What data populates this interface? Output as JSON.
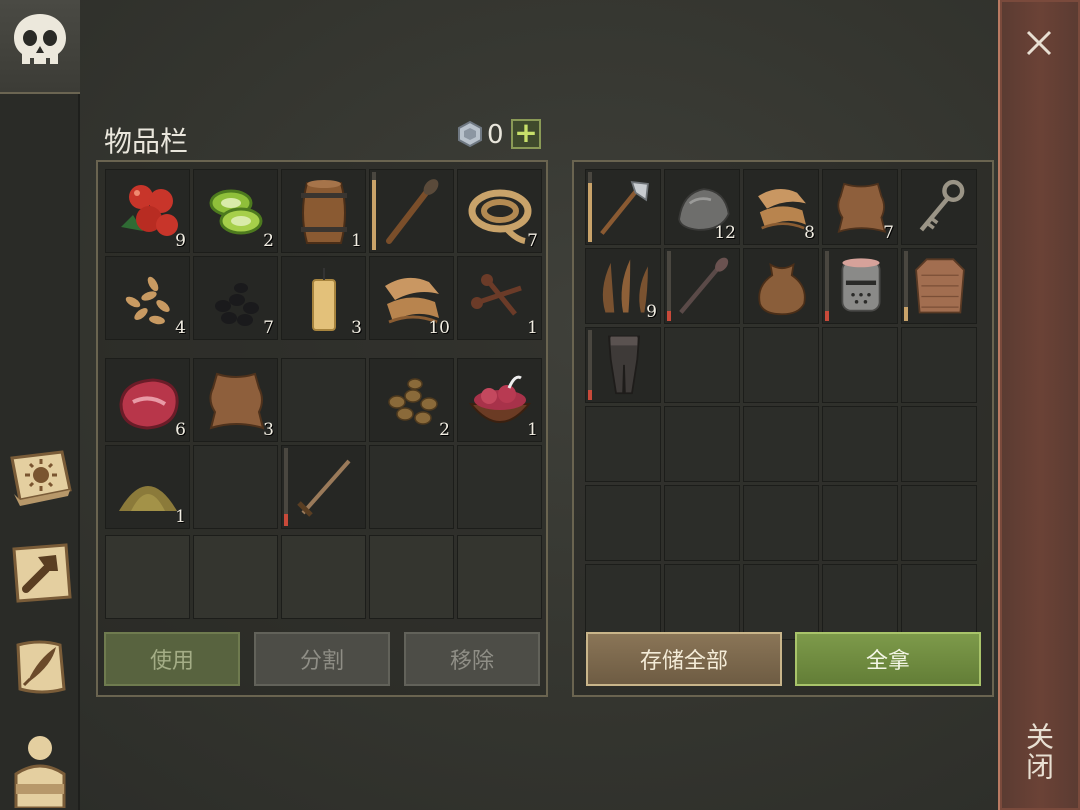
{
  "inventory": {
    "title": "物品栏",
    "gem_count": "0",
    "plus_label": "+",
    "slots": [
      {
        "icon": "berries-icon",
        "count": "9"
      },
      {
        "icon": "cucumber-slices-icon",
        "count": "2"
      },
      {
        "icon": "barrel-icon",
        "count": "1"
      },
      {
        "icon": "torch-icon",
        "count": "",
        "durability": 0.9,
        "dur_color": "#c9a36a"
      },
      {
        "icon": "rope-icon",
        "count": "7"
      },
      {
        "icon": "seeds-icon",
        "count": "4"
      },
      {
        "icon": "coal-icon",
        "count": "7"
      },
      {
        "icon": "candle-icon",
        "count": "3"
      },
      {
        "icon": "cloth-icon",
        "count": "10"
      },
      {
        "icon": "nails-icon",
        "count": "1"
      },
      {
        "icon": "raw-meat-icon",
        "count": "6"
      },
      {
        "icon": "leather-hide-icon",
        "count": "3"
      },
      {
        "icon": "",
        "count": ""
      },
      {
        "icon": "nuts-icon",
        "count": "2"
      },
      {
        "icon": "bowl-of-meat-icon",
        "count": "1"
      },
      {
        "icon": "powder-pile-icon",
        "count": "1"
      },
      {
        "icon": "",
        "count": ""
      },
      {
        "icon": "sword-icon",
        "count": "",
        "durability": 0.15,
        "dur_color": "#c84a3a"
      },
      {
        "icon": "",
        "count": ""
      },
      {
        "icon": "",
        "count": ""
      }
    ]
  },
  "storage": {
    "slots": [
      {
        "icon": "pickaxe-icon",
        "count": "",
        "durability": 0.85,
        "dur_color": "#c9a36a"
      },
      {
        "icon": "stone-icon",
        "count": "12"
      },
      {
        "icon": "cloth-icon",
        "count": "8"
      },
      {
        "icon": "leather-hide-icon",
        "count": "7"
      },
      {
        "icon": "key-icon",
        "count": ""
      },
      {
        "icon": "fiber-icon",
        "count": "9"
      },
      {
        "icon": "mace-icon",
        "count": "",
        "durability": 0.15,
        "dur_color": "#c84a3a"
      },
      {
        "icon": "sack-icon",
        "count": ""
      },
      {
        "icon": "knight-helmet-icon",
        "count": "",
        "durability": 0.15,
        "dur_color": "#c84a3a"
      },
      {
        "icon": "chainmail-icon",
        "count": "",
        "durability": 0.2,
        "dur_color": "#c9a36a"
      },
      {
        "icon": "leg-armor-icon",
        "count": "",
        "durability": 0.15,
        "dur_color": "#c84a3a"
      }
    ]
  },
  "buttons": {
    "use": "使用",
    "split": "分割",
    "remove": "移除",
    "store_all": "存储全部",
    "take_all": "全拿"
  },
  "close_label": "关闭",
  "sidebar": {
    "icons": [
      "skull-icon",
      "sun-book-icon",
      "hammer-icon",
      "scroll-quill-icon",
      "character-icon"
    ]
  }
}
